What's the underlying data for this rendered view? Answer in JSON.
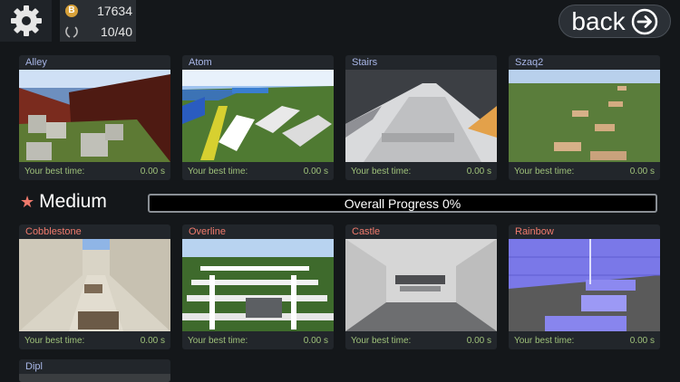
{
  "header": {
    "coins": "17634",
    "coin_symbol": "B",
    "levels_completed": "10/40",
    "back_label": "back"
  },
  "levels_top": [
    {
      "name": "Alley",
      "best_label": "Your best time:",
      "best_time": "0.00 s"
    },
    {
      "name": "Atom",
      "best_label": "Your best time:",
      "best_time": "0.00 s"
    },
    {
      "name": "Stairs",
      "best_label": "Your best time:",
      "best_time": "0.00 s"
    },
    {
      "name": "Szaq2",
      "best_label": "Your best time:",
      "best_time": "0.00 s"
    }
  ],
  "medium": {
    "title": "Medium",
    "progress_label": "Overall Progress 0%",
    "progress_value": 0
  },
  "levels_medium": [
    {
      "name": "Cobblestone",
      "best_label": "Your best time:",
      "best_time": "0.00 s"
    },
    {
      "name": "Overline",
      "best_label": "Your best time:",
      "best_time": "0.00 s"
    },
    {
      "name": "Castle",
      "best_label": "Your best time:",
      "best_time": "0.00 s"
    },
    {
      "name": "Rainbow",
      "best_label": "Your best time:",
      "best_time": "0.00 s"
    }
  ],
  "levels_partial": [
    {
      "name": "Dipl"
    }
  ],
  "colors": {
    "background": "#14171a",
    "card": "#22262b",
    "best_time_text": "#9fc27a",
    "medium_accent": "#f07a6c",
    "easy_title": "#a9b7e8"
  }
}
